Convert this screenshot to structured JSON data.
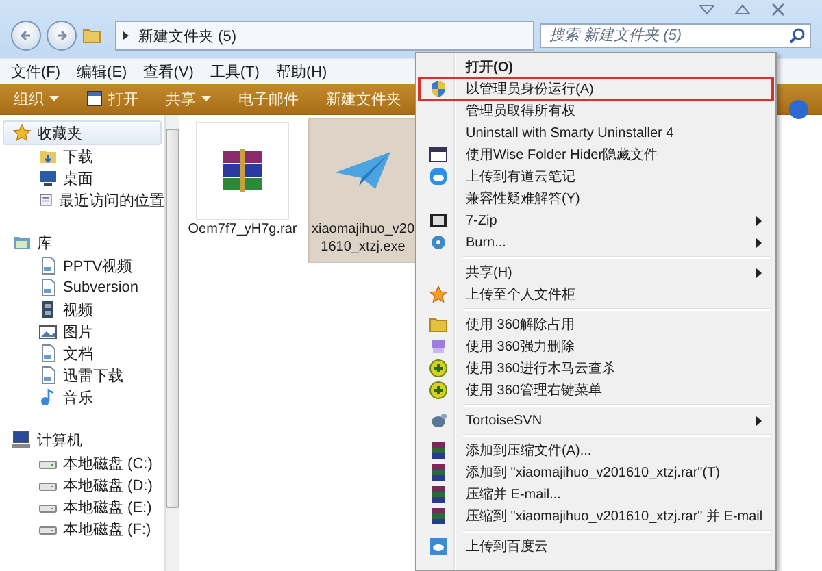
{
  "address": {
    "path": "新建文件夹 (5)",
    "search_placeholder": "搜索 新建文件夹 (5)"
  },
  "menu_bar": [
    "文件(F)",
    "编辑(E)",
    "查看(V)",
    "工具(T)",
    "帮助(H)"
  ],
  "toolbar": [
    {
      "label": "组织",
      "dropdown": true
    },
    {
      "label": "打开",
      "dropdown": false
    },
    {
      "label": "共享",
      "dropdown": true
    },
    {
      "label": "电子邮件",
      "dropdown": false
    },
    {
      "label": "新建文件夹",
      "dropdown": false
    }
  ],
  "sidebar": {
    "groups": [
      {
        "label": "收藏夹",
        "selected": true,
        "children": [
          {
            "label": "下载"
          },
          {
            "label": "桌面"
          },
          {
            "label": "最近访问的位置"
          }
        ]
      },
      {
        "label": "库",
        "selected": false,
        "children": [
          {
            "label": "PPTV视频"
          },
          {
            "label": "Subversion"
          },
          {
            "label": "视频"
          },
          {
            "label": "图片"
          },
          {
            "label": "文档"
          },
          {
            "label": "迅雷下载"
          },
          {
            "label": "音乐"
          }
        ]
      },
      {
        "label": "计算机",
        "selected": false,
        "children": [
          {
            "label": "本地磁盘 (C:)"
          },
          {
            "label": "本地磁盘 (D:)"
          },
          {
            "label": "本地磁盘 (E:)"
          },
          {
            "label": "本地磁盘 (F:)"
          }
        ]
      }
    ]
  },
  "files": [
    {
      "lines": [
        "Oem7f7_yH7g.rar"
      ],
      "kind": "rar",
      "selected": false
    },
    {
      "lines": [
        "xiaomajihuo_v20",
        "1610_xtzj.exe"
      ],
      "kind": "plane",
      "selected": true
    }
  ],
  "context_menu": [
    {
      "kind": "item",
      "label": "打开(O)",
      "default": true,
      "highlighted": false,
      "submenu": false
    },
    {
      "kind": "item",
      "label": "以管理员身份运行(A)",
      "default": false,
      "highlighted": true,
      "submenu": false
    },
    {
      "kind": "item",
      "label": "管理员取得所有权",
      "default": false,
      "highlighted": false,
      "submenu": false
    },
    {
      "kind": "item",
      "label": "Uninstall with Smarty Uninstaller 4",
      "default": false,
      "highlighted": false,
      "submenu": false
    },
    {
      "kind": "item",
      "label": "使用Wise Folder Hider隐藏文件",
      "default": false,
      "highlighted": false,
      "submenu": false
    },
    {
      "kind": "item",
      "label": "上传到有道云笔记",
      "default": false,
      "highlighted": false,
      "submenu": false
    },
    {
      "kind": "item",
      "label": "兼容性疑难解答(Y)",
      "default": false,
      "highlighted": false,
      "submenu": false
    },
    {
      "kind": "item",
      "label": "7-Zip",
      "default": false,
      "highlighted": false,
      "submenu": true
    },
    {
      "kind": "item",
      "label": "Burn...",
      "default": false,
      "highlighted": false,
      "submenu": true
    },
    {
      "kind": "separator"
    },
    {
      "kind": "item",
      "label": "共享(H)",
      "default": false,
      "highlighted": false,
      "submenu": true
    },
    {
      "kind": "item",
      "label": "上传至个人文件柜",
      "default": false,
      "highlighted": false,
      "submenu": false
    },
    {
      "kind": "separator"
    },
    {
      "kind": "item",
      "label": "使用 360解除占用",
      "default": false,
      "highlighted": false,
      "submenu": false
    },
    {
      "kind": "item",
      "label": "使用 360强力删除",
      "default": false,
      "highlighted": false,
      "submenu": false
    },
    {
      "kind": "item",
      "label": "使用 360进行木马云查杀",
      "default": false,
      "highlighted": false,
      "submenu": false
    },
    {
      "kind": "item",
      "label": "使用 360管理右键菜单",
      "default": false,
      "highlighted": false,
      "submenu": false
    },
    {
      "kind": "separator"
    },
    {
      "kind": "item",
      "label": "TortoiseSVN",
      "default": false,
      "highlighted": false,
      "submenu": true
    },
    {
      "kind": "separator"
    },
    {
      "kind": "item",
      "label": "添加到压缩文件(A)...",
      "default": false,
      "highlighted": false,
      "submenu": false
    },
    {
      "kind": "item",
      "label": "添加到 \"xiaomajihuo_v201610_xtzj.rar\"(T)",
      "default": false,
      "highlighted": false,
      "submenu": false
    },
    {
      "kind": "item",
      "label": "压缩并 E-mail...",
      "default": false,
      "highlighted": false,
      "submenu": false
    },
    {
      "kind": "item",
      "label": "压缩到 \"xiaomajihuo_v201610_xtzj.rar\" 并 E-mail",
      "default": false,
      "highlighted": false,
      "submenu": false
    },
    {
      "kind": "separator"
    },
    {
      "kind": "item",
      "label": "上传到百度云",
      "default": false,
      "highlighted": false,
      "submenu": false
    }
  ]
}
